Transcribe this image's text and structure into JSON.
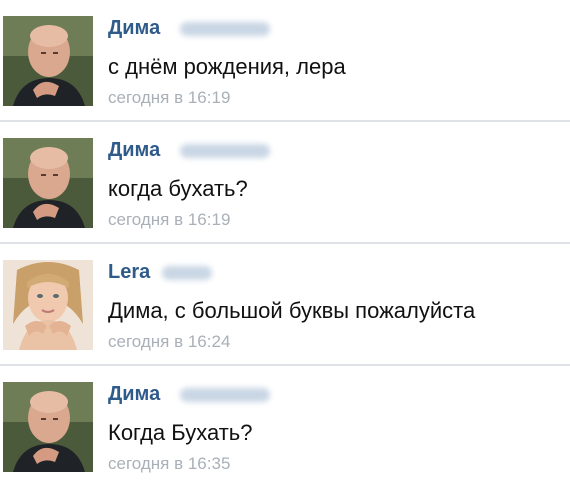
{
  "messages": [
    {
      "author": "Дима",
      "text": "с днём рождения, лера",
      "time": "сегодня в 16:19",
      "avatar_icon": "male-avatar"
    },
    {
      "author": "Дима",
      "text": "когда бухать?",
      "time": "сегодня в 16:19",
      "avatar_icon": "male-avatar"
    },
    {
      "author": "Lera",
      "text": "Дима, с большой буквы пожалуйста",
      "time": "сегодня в 16:24",
      "avatar_icon": "female-avatar"
    },
    {
      "author": "Дима",
      "text": "Когда Бухать?",
      "time": "сегодня в 16:35",
      "avatar_icon": "male-avatar"
    }
  ],
  "colors": {
    "author_name": "#2f5b8a",
    "message_text": "#111111",
    "timestamp": "#a9b0b8",
    "divider": "#dfe3e8"
  }
}
